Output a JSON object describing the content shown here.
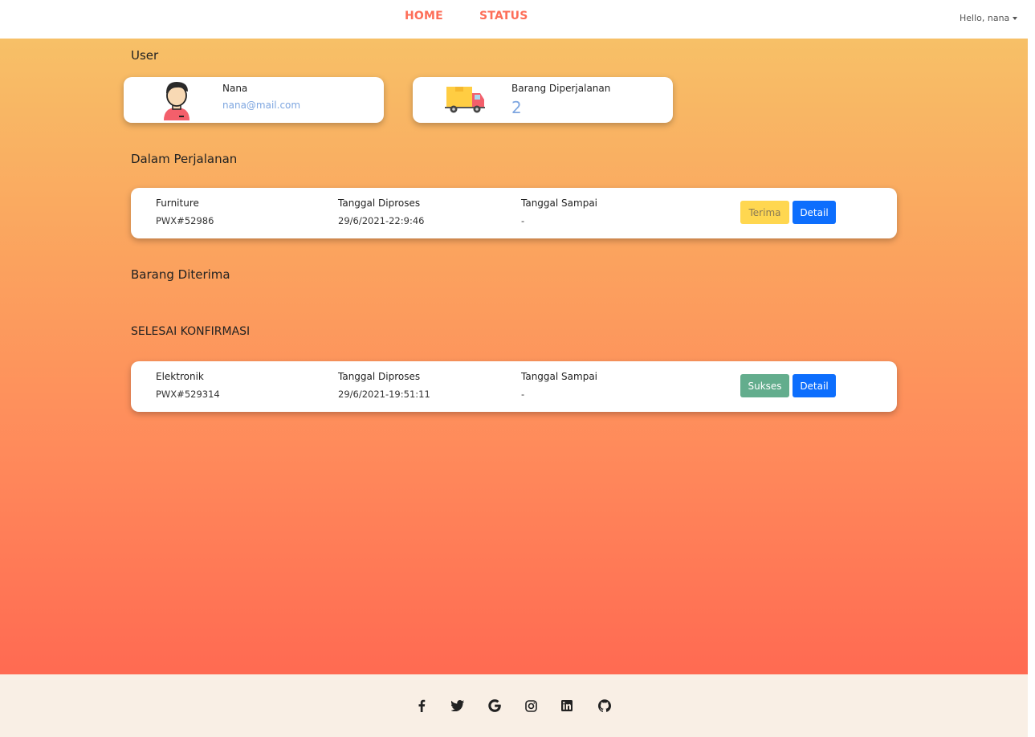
{
  "nav": {
    "home": "HOME",
    "status": "STATUS",
    "greeting": "Hello, nana"
  },
  "sections": {
    "user": "User",
    "in_transit": "Dalam Perjalanan",
    "received": "Barang Diterima",
    "confirmed": "SELESAI KONFIRMASI"
  },
  "user_card": {
    "name": "Nana",
    "email": "nana@mail.com"
  },
  "transit_card": {
    "label": "Barang Diperjalanan",
    "count": "2"
  },
  "in_transit_items": [
    {
      "category": "Furniture",
      "code": "PWX#52986",
      "processed_label": "Tanggal Diproses",
      "processed_date": "29/6/2021-22:9:46",
      "arrived_label": "Tanggal Sampai",
      "arrived_date": "-",
      "action_label": "Terima",
      "detail_label": "Detail"
    }
  ],
  "confirmed_items": [
    {
      "category": "Elektronik",
      "code": "PWX#529314",
      "processed_label": "Tanggal Diproses",
      "processed_date": "29/6/2021-19:51:11",
      "arrived_label": "Tanggal Sampai",
      "arrived_date": "-",
      "status_label": "Sukses",
      "detail_label": "Detail"
    }
  ],
  "footer": {
    "icons": [
      "facebook-icon",
      "twitter-icon",
      "google-icon",
      "instagram-icon",
      "linkedin-icon",
      "github-icon"
    ]
  },
  "colors": {
    "nav_accent": "#fd6e58",
    "gradient_top": "#f7c067",
    "gradient_bottom": "#ff6a52",
    "detail_button": "#0d6efd",
    "terima_button": "#ffd750",
    "sukses_button": "#63ad8d",
    "email_text": "#7ea6e0"
  }
}
